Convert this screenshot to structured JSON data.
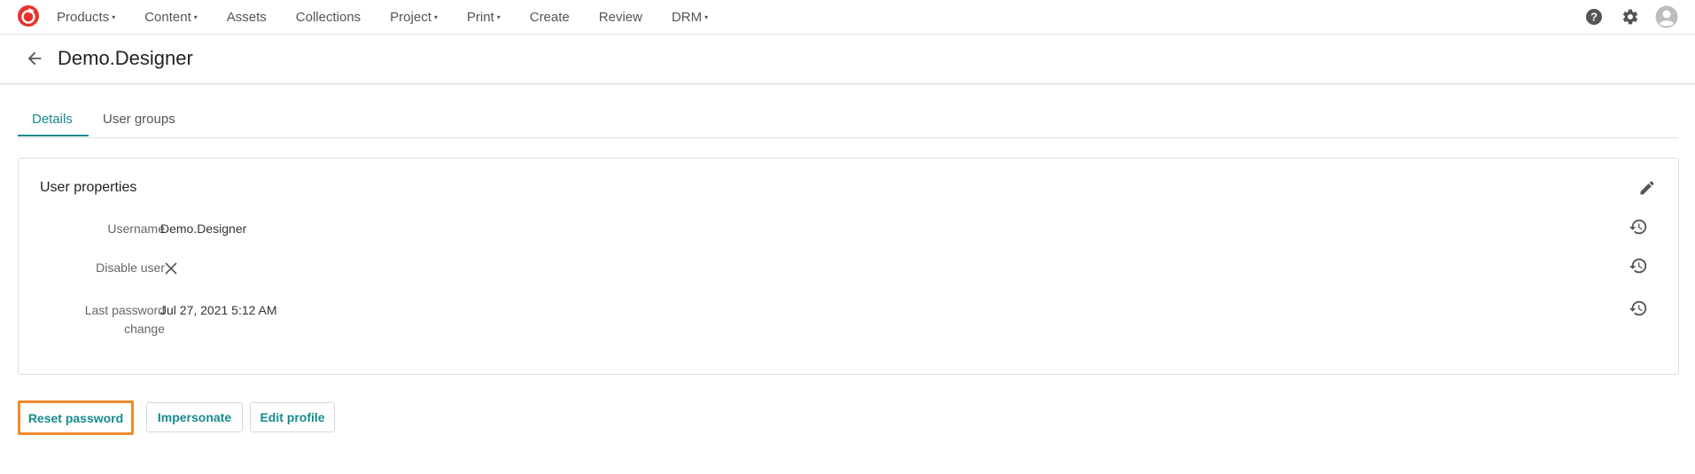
{
  "nav": {
    "items": [
      {
        "label": "Products",
        "caret": "▾"
      },
      {
        "label": "Content",
        "caret": "▾"
      },
      {
        "label": "Assets",
        "caret": ""
      },
      {
        "label": "Collections",
        "caret": ""
      },
      {
        "label": "Project",
        "caret": "▾"
      },
      {
        "label": "Print",
        "caret": "▾"
      },
      {
        "label": "Create",
        "caret": ""
      },
      {
        "label": "Review",
        "caret": ""
      },
      {
        "label": "DRM",
        "caret": "▾"
      }
    ],
    "right_icons": [
      "help-icon",
      "gear-icon",
      "avatar-icon"
    ]
  },
  "header": {
    "title": "Demo.Designer"
  },
  "tabs": [
    {
      "label": "Details",
      "active": true
    },
    {
      "label": "User groups",
      "active": false
    }
  ],
  "panel": {
    "title": "User properties",
    "properties": [
      {
        "label": "Username",
        "value": "Demo.Designer"
      },
      {
        "label": "Disable user",
        "value": ""
      },
      {
        "label": "Last password change",
        "value": "Jul 27, 2021 5:12 AM"
      }
    ]
  },
  "actions": {
    "reset_label": "Reset password",
    "impersonate_label": "Impersonate",
    "edit_label": "Edit profile"
  },
  "colors": {
    "accent": "#168a8f",
    "highlight": "#f08a2c",
    "logo": "#e8322b"
  }
}
